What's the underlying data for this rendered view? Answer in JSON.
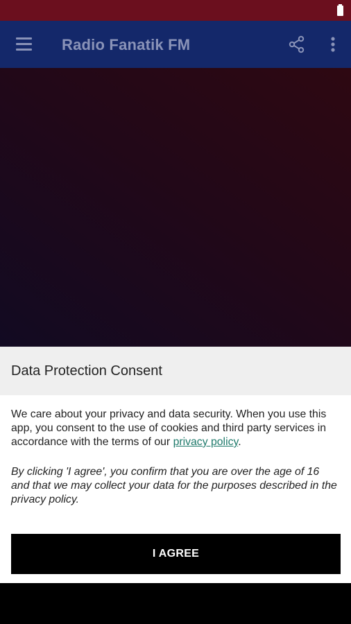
{
  "status_bar": {
    "battery_icon": "battery-full-icon"
  },
  "app_bar": {
    "title": "Radio Fanatik FM",
    "menu_icon": "hamburger-menu-icon",
    "share_icon": "share-icon",
    "more_icon": "more-vertical-icon"
  },
  "colors": {
    "status_bar": "#6b0f1e",
    "app_bar": "#14286a",
    "link": "#1f7a6b"
  },
  "dialog": {
    "title": "Data Protection Consent",
    "body_before_link": "We care about your privacy and data security. When you use this app, you consent to the use of cookies and third party services in accordance with the terms of our ",
    "link_text": "privacy policy",
    "body_after_link": ".",
    "italic_text": "By clicking 'I agree', you confirm that you are over the age of 16 and that we may collect your data for the purposes described in the privacy policy.",
    "agree_label": "I AGREE"
  }
}
